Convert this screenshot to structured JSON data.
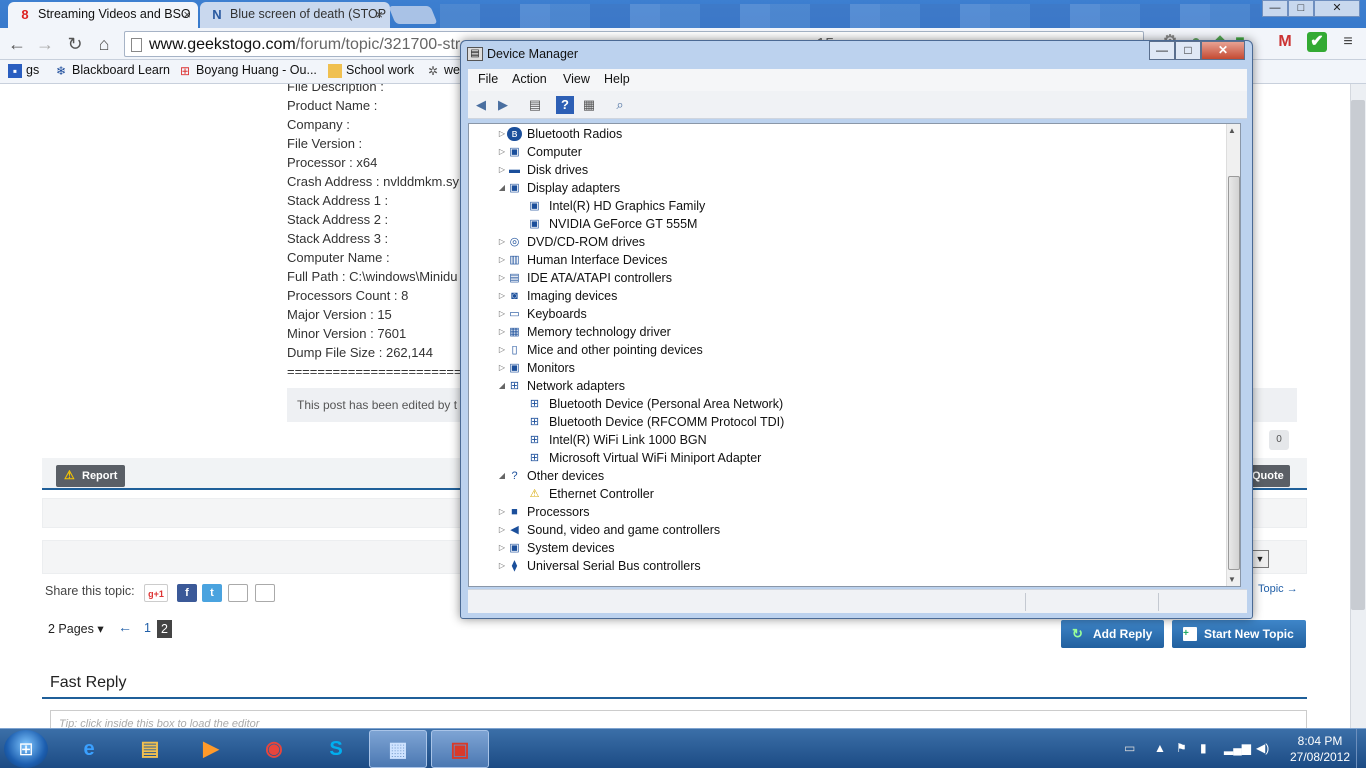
{
  "browser": {
    "tabs": [
      {
        "title": "Streaming Videos and BSO",
        "favicon": "8",
        "active": true
      },
      {
        "title": "Blue screen of death (STOP",
        "favicon": "N",
        "active": false
      }
    ],
    "window_controls": {
      "minimize": "—",
      "maximize": "□",
      "close": "✕"
    },
    "nav": {
      "back": "←",
      "forward": "→",
      "reload": "↻",
      "home": "⌂"
    },
    "url": {
      "host": "www.geekstogo.com",
      "path": "/forum/topic/321700-stre"
    },
    "url_tail": "-15",
    "bookmarks": [
      {
        "label": "gs",
        "icon": "bookmark-icon"
      },
      {
        "label": "Blackboard Learn",
        "icon": "snowflake-icon"
      },
      {
        "label": "Boyang Huang - Ou...",
        "icon": "windows-icon"
      },
      {
        "label": "School work",
        "icon": "folder-icon"
      },
      {
        "label": "we",
        "icon": "gear-icon"
      }
    ],
    "extensions": [
      "M",
      "✔",
      "≡"
    ]
  },
  "forum": {
    "info_lines": [
      "File Description :",
      "Product Name :",
      "Company :",
      "File Version :",
      "Processor : x64",
      "Crash Address : nvlddmkm.sy",
      "Stack Address 1 :",
      "Stack Address 2 :",
      "Stack Address 3 :",
      "Computer Name :",
      "Full Path : C:\\windows\\Minidu",
      "Processors Count : 8",
      "Major Version : 15",
      "Minor Version : 7601",
      "Dump File Size : 262,144",
      "======================="
    ],
    "edited_note": "This post has been edited by t",
    "reputation": "0",
    "report_label": "Report",
    "quote_label": "Quote",
    "share_label": "Share this topic:",
    "share_icons": [
      "g+1",
      "f",
      "t",
      "print",
      "download"
    ],
    "next_topic": "Topic →",
    "pages_label": "2 Pages ▾",
    "prev_arrow": "←",
    "page_numbers": [
      "1",
      "2"
    ],
    "add_reply": "Add Reply",
    "start_new_topic": "Start New Topic",
    "fast_reply": "Fast Reply",
    "editor_hint": "Tip: click inside this box to load the editor"
  },
  "device_manager": {
    "title": "Device Manager",
    "window_controls": {
      "minimize": "—",
      "maximize": "□",
      "close": "✕"
    },
    "menu": [
      "File",
      "Action",
      "View",
      "Help"
    ],
    "tree": [
      {
        "label": "Bluetooth Radios",
        "level": 0,
        "expanded": false,
        "icon": "bluetooth-icon"
      },
      {
        "label": "Computer",
        "level": 0,
        "expanded": false,
        "icon": "computer-icon"
      },
      {
        "label": "Disk drives",
        "level": 0,
        "expanded": false,
        "icon": "disk-icon"
      },
      {
        "label": "Display adapters",
        "level": 0,
        "expanded": true,
        "icon": "display-icon"
      },
      {
        "label": "Intel(R) HD Graphics Family",
        "level": 1,
        "icon": "display-icon"
      },
      {
        "label": "NVIDIA GeForce GT 555M",
        "level": 1,
        "icon": "display-icon"
      },
      {
        "label": "DVD/CD-ROM drives",
        "level": 0,
        "expanded": false,
        "icon": "dvd-icon"
      },
      {
        "label": "Human Interface Devices",
        "level": 0,
        "expanded": false,
        "icon": "hid-icon"
      },
      {
        "label": "IDE ATA/ATAPI controllers",
        "level": 0,
        "expanded": false,
        "icon": "ide-icon"
      },
      {
        "label": "Imaging devices",
        "level": 0,
        "expanded": false,
        "icon": "camera-icon"
      },
      {
        "label": "Keyboards",
        "level": 0,
        "expanded": false,
        "icon": "keyboard-icon"
      },
      {
        "label": "Memory technology driver",
        "level": 0,
        "expanded": false,
        "icon": "memory-icon"
      },
      {
        "label": "Mice and other pointing devices",
        "level": 0,
        "expanded": false,
        "icon": "mouse-icon"
      },
      {
        "label": "Monitors",
        "level": 0,
        "expanded": false,
        "icon": "monitor-icon"
      },
      {
        "label": "Network adapters",
        "level": 0,
        "expanded": true,
        "icon": "network-icon"
      },
      {
        "label": "Bluetooth Device (Personal Area Network)",
        "level": 1,
        "icon": "network-icon"
      },
      {
        "label": "Bluetooth Device (RFCOMM Protocol TDI)",
        "level": 1,
        "icon": "network-icon"
      },
      {
        "label": "Intel(R) WiFi Link 1000 BGN",
        "level": 1,
        "icon": "network-icon"
      },
      {
        "label": "Microsoft Virtual WiFi Miniport Adapter",
        "level": 1,
        "icon": "network-icon"
      },
      {
        "label": "Other devices",
        "level": 0,
        "expanded": true,
        "icon": "unknown-device-icon"
      },
      {
        "label": "Ethernet Controller",
        "level": 1,
        "icon": "warning-icon"
      },
      {
        "label": "Processors",
        "level": 0,
        "expanded": false,
        "icon": "processor-icon"
      },
      {
        "label": "Sound, video and game controllers",
        "level": 0,
        "expanded": false,
        "icon": "speaker-icon"
      },
      {
        "label": "System devices",
        "level": 0,
        "expanded": false,
        "icon": "system-icon"
      },
      {
        "label": "Universal Serial Bus controllers",
        "level": 0,
        "expanded": false,
        "icon": "usb-icon"
      }
    ]
  },
  "taskbar": {
    "clock_time": "8:04 PM",
    "clock_date": "27/08/2012",
    "apps": [
      {
        "name": "internet-explorer-icon",
        "glyph": "e",
        "color": "#3aa0ff"
      },
      {
        "name": "file-explorer-icon",
        "glyph": "▤",
        "color": "#f0c050"
      },
      {
        "name": "media-player-icon",
        "glyph": "▶",
        "color": "#ff9a2a"
      },
      {
        "name": "chrome-icon",
        "glyph": "◉",
        "color": "#e8453c"
      },
      {
        "name": "skype-icon",
        "glyph": "S",
        "color": "#00aff0"
      },
      {
        "name": "control-panel-icon",
        "glyph": "▦",
        "color": "#cfe3ff"
      },
      {
        "name": "device-manager-toolbox-icon",
        "glyph": "▣",
        "color": "#d83a2a"
      }
    ]
  },
  "colors": {
    "accent": "#1f5f99",
    "button_blue": "#2e74b8",
    "title_bar": "#bcd2ee"
  }
}
